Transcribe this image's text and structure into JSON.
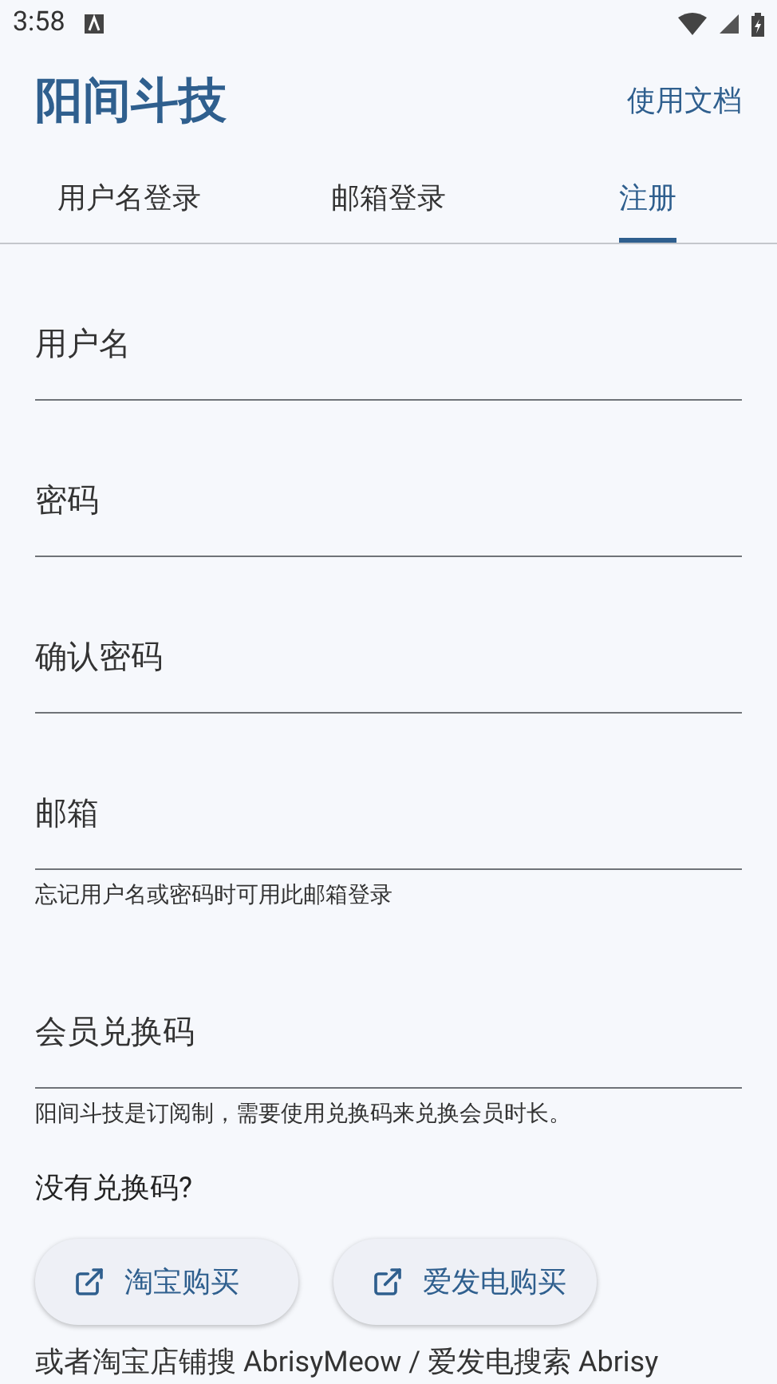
{
  "status_bar": {
    "time": "3:58"
  },
  "app_bar": {
    "title": "阳间斗技",
    "action": "使用文档"
  },
  "tabs": [
    {
      "label": "用户名登录",
      "selected": false
    },
    {
      "label": "邮箱登录",
      "selected": false
    },
    {
      "label": "注册",
      "selected": true
    }
  ],
  "fields": [
    {
      "placeholder": "用户名"
    },
    {
      "placeholder": "密码"
    },
    {
      "placeholder": "确认密码"
    },
    {
      "placeholder": "邮箱",
      "helper": "忘记用户名或密码时可用此邮箱登录"
    },
    {
      "placeholder": "会员兑换码",
      "helper": "阳间斗技是订阅制，需要使用兑换码来兑换会员时长。"
    }
  ],
  "no_code_heading": "没有兑换码?",
  "buy_buttons": [
    "淘宝购买",
    "爱发电购买"
  ],
  "footer_note": "或者淘宝店铺搜 AbrisyMeow / 爱发电搜索 Abrisy"
}
